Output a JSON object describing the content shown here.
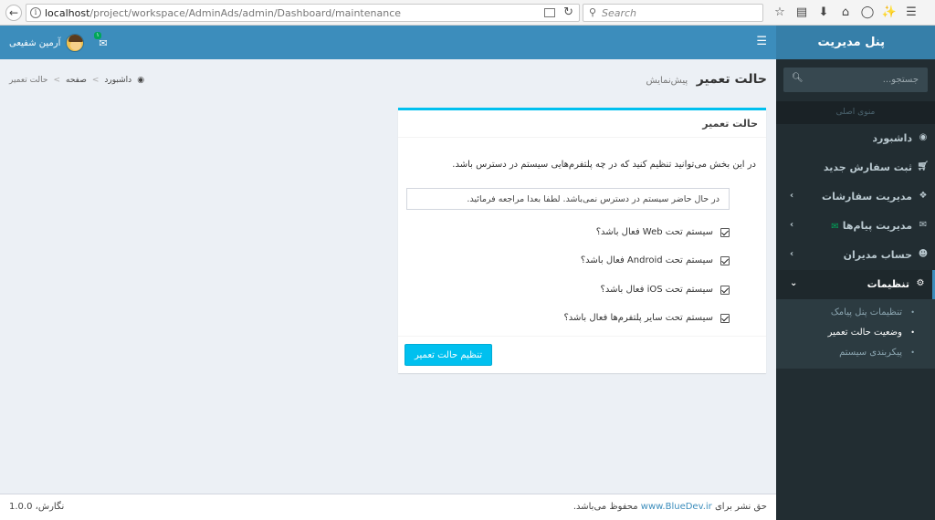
{
  "browser": {
    "url_host": "localhost",
    "url_path": "/project/workspace/AdminAds/admin/Dashboard/maintenance",
    "search_placeholder": "Search"
  },
  "sidebar": {
    "brand": "پنل مدیریت",
    "search_placeholder": "جستجو...",
    "section_header": "منوی اصلی",
    "items": [
      {
        "label": "داشبورد",
        "icon": "dashboard-icon"
      },
      {
        "label": "ثبت سفارش جدید",
        "icon": "cart-icon"
      },
      {
        "label": "مدیریت سفارشات",
        "icon": "cubes-icon"
      },
      {
        "label": "مدیریت پیام‌ها",
        "icon": "envelope-icon"
      },
      {
        "label": "حساب مدیران",
        "icon": "user-icon"
      },
      {
        "label": "تنظیمات",
        "icon": "gear-icon"
      }
    ],
    "subitems": [
      {
        "label": "تنظیمات پنل پیامک"
      },
      {
        "label": "وضعیت حالت تعمیر"
      },
      {
        "label": "پیکربندی سیستم"
      }
    ]
  },
  "header": {
    "username": "آرمین شفیعی",
    "mail_count": "۱"
  },
  "content": {
    "title": "حالت تعمیر",
    "subtitle": "پیش‌نمایش",
    "breadcrumb": [
      "داشبورد",
      "صفحه",
      "حالت تعمیر"
    ]
  },
  "box": {
    "title": "حالت تعمیر",
    "description": "در این بخش می‌توانید تنظیم کنید که در چه پلتفرم‌هایی سیستم در دسترس باشد.",
    "notice": "در حال حاضر سیستم در دسترس نمی‌باشد. لطفا بعدا مراجعه فرمائید.",
    "checkboxes": [
      {
        "label": "سیستم تحت Web فعال باشد؟",
        "checked": true
      },
      {
        "label": "سیستم تحت Android فعال باشد؟",
        "checked": true
      },
      {
        "label": "سیستم تحت iOS فعال باشد؟",
        "checked": true
      },
      {
        "label": "سیستم تحت سایر پلتفرم‌ها فعال باشد؟",
        "checked": true
      }
    ],
    "submit_label": "تنظیم حالت تعمیر"
  },
  "footer": {
    "copyright_prefix": "حق نشر برای",
    "copyright_link": "www.BlueDev.ir",
    "copyright_suffix": "محفوظ می‌باشد.",
    "version": "نگارش، 1.0.0"
  },
  "colors": {
    "header_blue": "#3c8dbc",
    "brand_blue": "#367fa9",
    "sidebar_dark": "#222d32",
    "accent_cyan": "#00c0ef",
    "badge_green": "#00a65a"
  }
}
